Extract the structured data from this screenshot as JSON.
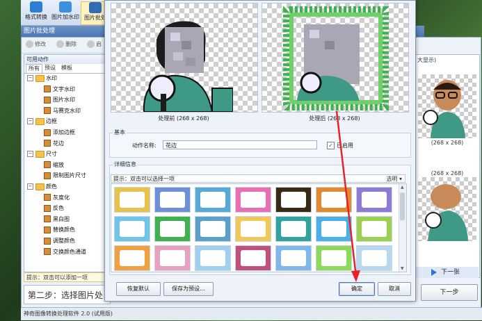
{
  "toolbar": {
    "buttons": [
      {
        "label": "格式转换",
        "color": "#2d7fd6"
      },
      {
        "label": "图片加水印",
        "color": "#3f8fe0"
      },
      {
        "label": "图片批处",
        "color": "#2f6db5"
      }
    ]
  },
  "back_window": {
    "title": "图片批处理",
    "tools": {
      "edit": "修改",
      "delete": "删除",
      "preview": "启"
    },
    "left_panel": {
      "title": "可用动作",
      "tabs": [
        "所有",
        "预设",
        "模板"
      ],
      "tree": [
        {
          "label": "水印",
          "kind": "folder"
        },
        {
          "label": "文字水印",
          "kind": "item"
        },
        {
          "label": "图片水印",
          "kind": "item"
        },
        {
          "label": "马赛克水印",
          "kind": "item"
        },
        {
          "label": "边框",
          "kind": "folder"
        },
        {
          "label": "添加边框",
          "kind": "item"
        },
        {
          "label": "花边",
          "kind": "item"
        },
        {
          "label": "尺寸",
          "kind": "folder"
        },
        {
          "label": "缩放",
          "kind": "item"
        },
        {
          "label": "限制图片尺寸",
          "kind": "item"
        },
        {
          "label": "颜色",
          "kind": "folder"
        },
        {
          "label": "灰度化",
          "kind": "item"
        },
        {
          "label": "反色",
          "kind": "item"
        },
        {
          "label": "黑白图",
          "kind": "item"
        },
        {
          "label": "替换颜色",
          "kind": "item"
        },
        {
          "label": "调整颜色",
          "kind": "item"
        },
        {
          "label": "交换颜色通道",
          "kind": "item"
        }
      ],
      "hint": "提示：双击可以添加一项"
    },
    "step2": "第二步：选择图片处",
    "right_panel": {
      "header": "大显示)",
      "size_top": "(268 x 268)",
      "size_bottom": "(268 x 268)"
    },
    "next_small": "下一张",
    "next_step": "下一步",
    "status": "神奇图像转换处理软件 2.0 (试用版)"
  },
  "dialog": {
    "preview_before_caption": "处理前 (268 x 268)",
    "preview_after_caption": "处理后 (268 x 268)",
    "basic_group": "基本",
    "action_name_label": "动作名称:",
    "action_name_value": "花边",
    "enabled_label": "已启用",
    "enabled": true,
    "details_group": "详细信息",
    "hint": "提示：双击可以选择一项",
    "desc_dropdown": "选明 ▾",
    "frames_colors": [
      [
        "#e8c24a",
        "#6f8fd8",
        "#58a8d8",
        "#e86fb3",
        "#3a2a14",
        "#e08a2d",
        "#8d7ad4"
      ],
      [
        "#6fc4e8",
        "#3fb24f",
        "#5aa0c8",
        "#f0c85a",
        "#2ea3a0",
        "#4cb0e8",
        "#9ad24f"
      ],
      [
        "#f0a040",
        "#e8a0c0",
        "#9fd0f0",
        "#c05080",
        "#7fb8e8",
        "#8ed85a",
        "#b8d8f0"
      ]
    ],
    "buttons": {
      "reset": "恢复默认",
      "save_preset": "保存为预设...",
      "ok": "确定",
      "cancel": "取消"
    }
  },
  "colors": {
    "annotation_arrow": "#e8212b"
  }
}
